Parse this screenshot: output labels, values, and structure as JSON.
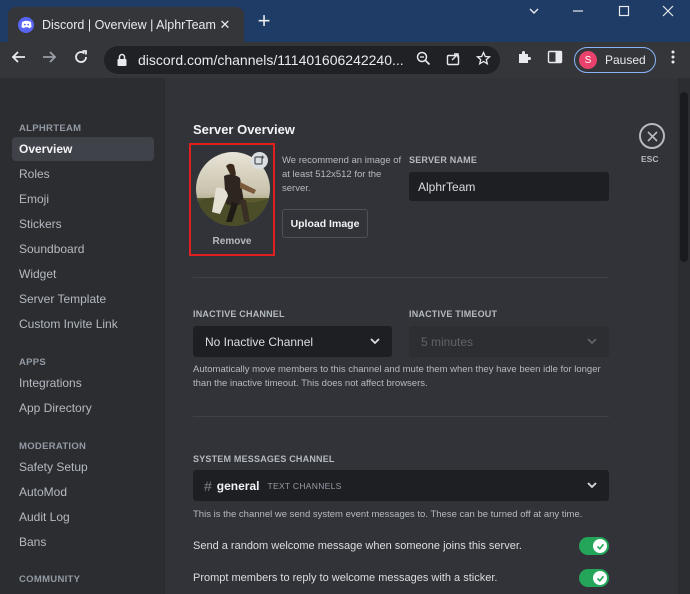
{
  "browser": {
    "tab_title": "Discord | Overview | AlphrTeam",
    "tab_close": "✕",
    "new_tab": "+",
    "url": "discord.com/channels/111401606242240...",
    "profile_initial": "S",
    "profile_status": "Paused"
  },
  "sidebar": {
    "sections": [
      {
        "title": "ALPHRTEAM",
        "items": [
          "Overview",
          "Roles",
          "Emoji",
          "Stickers",
          "Soundboard",
          "Widget",
          "Server Template",
          "Custom Invite Link"
        ]
      },
      {
        "title": "APPS",
        "items": [
          "Integrations",
          "App Directory"
        ]
      },
      {
        "title": "MODERATION",
        "items": [
          "Safety Setup",
          "AutoMod",
          "Audit Log",
          "Bans"
        ]
      },
      {
        "title": "COMMUNITY",
        "items": []
      }
    ],
    "active_item": "Overview"
  },
  "main": {
    "title": "Server Overview",
    "esc_label": "ESC",
    "icon": {
      "remove_label": "Remove",
      "recommend_text": "We recommend an image of at least 512x512 for the server.",
      "upload_button": "Upload Image"
    },
    "server_name": {
      "label": "SERVER NAME",
      "value": "AlphrTeam"
    },
    "inactive_channel": {
      "label": "INACTIVE CHANNEL",
      "value": "No Inactive Channel"
    },
    "inactive_timeout": {
      "label": "INACTIVE TIMEOUT",
      "value": "5 minutes"
    },
    "inactive_help": "Automatically move members to this channel and mute them when they have been idle for longer than the inactive timeout. This does not affect browsers.",
    "system_messages": {
      "label": "SYSTEM MESSAGES CHANNEL",
      "hash": "#",
      "channel": "general",
      "category": "TEXT CHANNELS",
      "help": "This is the channel we send system event messages to. These can be turned off at any time."
    },
    "toggles": [
      {
        "label": "Send a random welcome message when someone joins this server.",
        "on": true
      },
      {
        "label": "Prompt members to reply to welcome messages with a sticker.",
        "on": true
      }
    ]
  },
  "colors": {
    "accent_red_box": "#e01f1f",
    "toggle_on": "#23a55a",
    "blurple": "#5865f2"
  }
}
